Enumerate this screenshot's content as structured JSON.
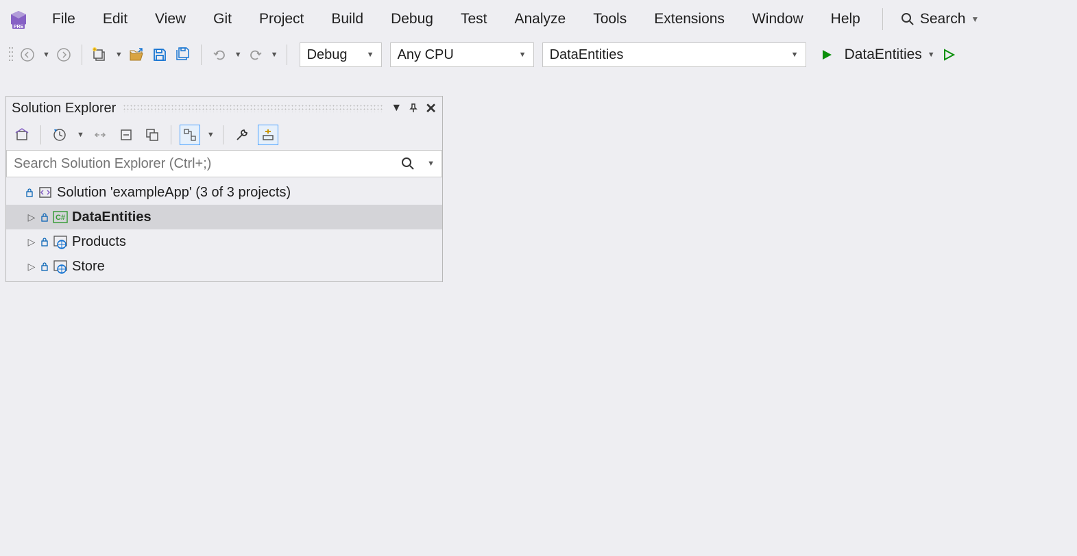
{
  "menu": {
    "items": [
      "File",
      "Edit",
      "View",
      "Git",
      "Project",
      "Build",
      "Debug",
      "Test",
      "Analyze",
      "Tools",
      "Extensions",
      "Window",
      "Help"
    ],
    "search_label": "Search"
  },
  "toolbar": {
    "configuration": "Debug",
    "platform": "Any CPU",
    "startup_project": "DataEntities",
    "startup_label": "DataEntities"
  },
  "solution_explorer": {
    "title": "Solution Explorer",
    "search_placeholder": "Search Solution Explorer (Ctrl+;)",
    "root": "Solution 'exampleApp' (3 of 3 projects)",
    "projects": [
      {
        "name": "DataEntities",
        "type": "csharp",
        "selected": true,
        "bold": true
      },
      {
        "name": "Products",
        "type": "web",
        "selected": false,
        "bold": false
      },
      {
        "name": "Store",
        "type": "web",
        "selected": false,
        "bold": false
      }
    ]
  }
}
